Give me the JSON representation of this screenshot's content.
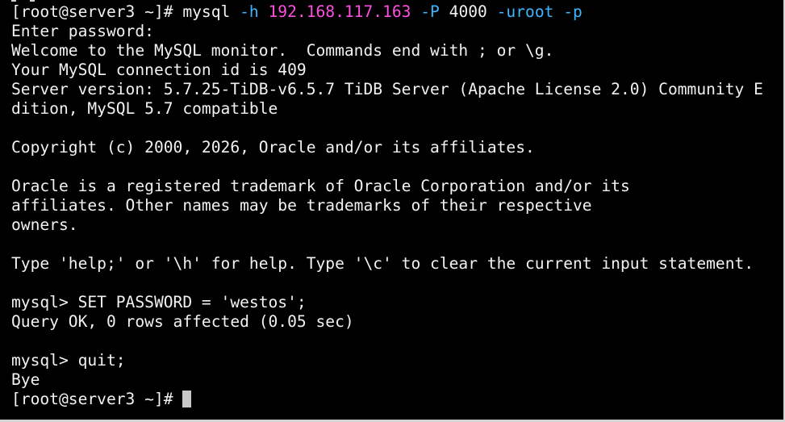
{
  "terminal": {
    "lines": [
      [
        {
          "t": "[root@server3 ~]# mysql ",
          "c": "default"
        },
        {
          "t": "-h ",
          "c": "flag"
        },
        {
          "t": "192.168.117.163",
          "c": "host"
        },
        {
          "t": " ",
          "c": "default"
        },
        {
          "t": "-P ",
          "c": "flag"
        },
        {
          "t": "4000",
          "c": "num"
        },
        {
          "t": " ",
          "c": "default"
        },
        {
          "t": "-uroot",
          "c": "flag"
        },
        {
          "t": " ",
          "c": "default"
        },
        {
          "t": "-p",
          "c": "flag"
        }
      ],
      [
        {
          "t": "Enter password:",
          "c": "default"
        }
      ],
      [
        {
          "t": "Welcome to the MySQL monitor.  Commands end with ; or \\g.",
          "c": "default"
        }
      ],
      [
        {
          "t": "Your MySQL connection id is 409",
          "c": "default"
        }
      ],
      [
        {
          "t": "Server version: 5.7.25-TiDB-v6.5.7 TiDB Server (Apache License 2.0) Community E",
          "c": "default"
        }
      ],
      [
        {
          "t": "dition, MySQL 5.7 compatible",
          "c": "default"
        }
      ],
      [
        {
          "t": "",
          "c": "default"
        }
      ],
      [
        {
          "t": "Copyright (c) 2000, 2026, Oracle and/or its affiliates.",
          "c": "default"
        }
      ],
      [
        {
          "t": "",
          "c": "default"
        }
      ],
      [
        {
          "t": "Oracle is a registered trademark of Oracle Corporation and/or its",
          "c": "default"
        }
      ],
      [
        {
          "t": "affiliates. Other names may be trademarks of their respective",
          "c": "default"
        }
      ],
      [
        {
          "t": "owners.",
          "c": "default"
        }
      ],
      [
        {
          "t": "",
          "c": "default"
        }
      ],
      [
        {
          "t": "Type 'help;' or '\\h' for help. Type '\\c' to clear the current input statement.",
          "c": "default"
        }
      ],
      [
        {
          "t": "",
          "c": "default"
        }
      ],
      [
        {
          "t": "mysql> SET PASSWORD = 'westos';",
          "c": "default"
        }
      ],
      [
        {
          "t": "Query OK, 0 rows affected (0.05 sec)",
          "c": "default"
        }
      ],
      [
        {
          "t": "",
          "c": "default"
        }
      ],
      [
        {
          "t": "mysql> quit;",
          "c": "default"
        }
      ],
      [
        {
          "t": "Bye",
          "c": "default"
        }
      ],
      [
        {
          "t": "[root@server3 ~]# ",
          "c": "default",
          "cursor": true
        }
      ]
    ],
    "colors": {
      "background": "#000000",
      "text": "#f2f2f2",
      "flag": "#3db5ff",
      "host": "#ff4fe1",
      "cursor": "#c8c8c8",
      "border": "#d4d4d4"
    }
  }
}
